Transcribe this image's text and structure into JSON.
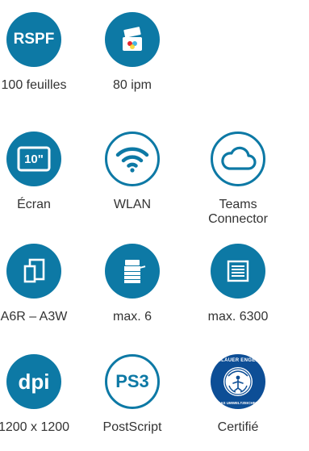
{
  "colors": {
    "accent": "#0d79a5",
    "text": "#333333",
    "background": "#ffffff"
  },
  "features": [
    {
      "id": "rspf",
      "badge_text": "RSPF",
      "icon": "document-feeder-icon",
      "label": "100 feuilles"
    },
    {
      "id": "speed",
      "badge_text": "",
      "icon": "printer-output-icon",
      "label": "80 ipm"
    },
    {
      "id": "screen",
      "badge_text": "10\"",
      "icon": "screen-icon",
      "label": "Écran"
    },
    {
      "id": "wlan",
      "badge_text": "",
      "icon": "wifi-icon",
      "label": "WLAN"
    },
    {
      "id": "teams",
      "badge_text": "",
      "icon": "cloud-icon",
      "label": "Teams\nConnector"
    },
    {
      "id": "paper-size",
      "badge_text": "",
      "icon": "paper-sizes-icon",
      "label": "A6R – A3W"
    },
    {
      "id": "trays",
      "badge_text": "",
      "icon": "multifunction-printer-icon",
      "label": "max. 6"
    },
    {
      "id": "capacity",
      "badge_text": "",
      "icon": "paper-stack-icon",
      "label": "max. 6300"
    },
    {
      "id": "resolution",
      "badge_text": "dpi",
      "icon": "dpi-icon",
      "label": "1200 x 1200"
    },
    {
      "id": "postscript",
      "badge_text": "PS3",
      "icon": "postscript-icon",
      "label": "PostScript"
    },
    {
      "id": "ecolabel",
      "badge_text": "BLAUER ENGEL",
      "badge_subtext": "DAS UMWELTZEICHEN",
      "icon": "blue-angel-icon",
      "label": "Certifié"
    }
  ]
}
